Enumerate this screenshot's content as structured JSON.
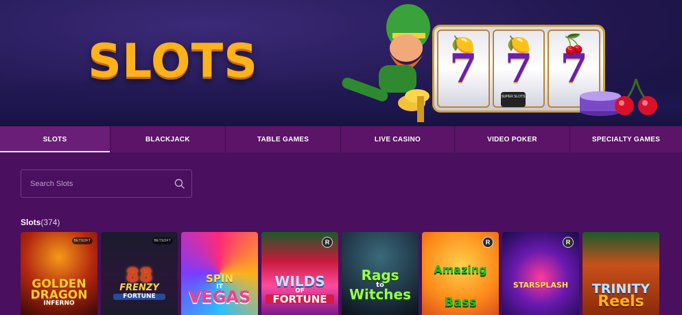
{
  "hero": {
    "title": "SLOTS",
    "badge_text": "SUPER SLOTS"
  },
  "tabs": [
    {
      "label": "SLOTS",
      "active": true
    },
    {
      "label": "BLACKJACK",
      "active": false
    },
    {
      "label": "TABLE GAMES",
      "active": false
    },
    {
      "label": "LIVE CASINO",
      "active": false
    },
    {
      "label": "VIDEO POKER",
      "active": false
    },
    {
      "label": "SPECIALTY GAMES",
      "active": false
    }
  ],
  "search": {
    "placeholder": "Search Slots",
    "value": ""
  },
  "section": {
    "name": "Slots",
    "count": "(374)"
  },
  "games": [
    {
      "title_line1": "GOLDEN",
      "title_line2": "DRAGON",
      "title_line3": "INFERNO",
      "provider_badge": "BETSOFT"
    },
    {
      "title_line1": "88",
      "title_line2": "FRENZY",
      "title_line3": "FORTUNE",
      "provider_badge": "BETSOFT"
    },
    {
      "title_line1": "SPIN",
      "title_line2": "IT",
      "title_line3": "VEGAS",
      "provider_badge": ""
    },
    {
      "title_line1": "WILDS",
      "title_line2": "OF",
      "title_line3": "FORTUNE",
      "provider_badge": "R"
    },
    {
      "title_line1": "Rags",
      "title_line2": "to",
      "title_line3": "Witches",
      "provider_badge": ""
    },
    {
      "title_line1": "Amazing",
      "title_line2": "Bass",
      "title_line3": "",
      "provider_badge": "R"
    },
    {
      "title_line1": "STARSPLASH",
      "title_line2": "",
      "title_line3": "",
      "provider_badge": "R"
    },
    {
      "title_line1": "TRINITY",
      "title_line2": "Reels",
      "title_line3": "",
      "provider_badge": ""
    }
  ],
  "colors": {
    "background": "#4a0f5e",
    "tab_bar": "#5b1468",
    "hero_title": "#ffb21a",
    "accent_purple": "#6a1fb0"
  }
}
